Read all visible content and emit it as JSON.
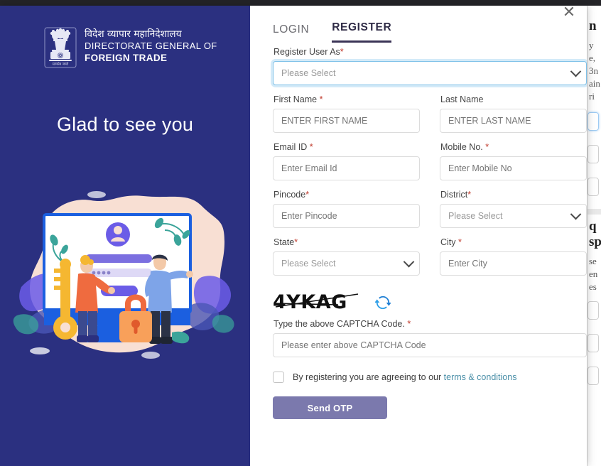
{
  "window": {
    "top_strip_color": "#242428"
  },
  "brand": {
    "hindi": "विदेश व्यापार महानिदेशालय",
    "line1": "DIRECTORATE GENERAL OF",
    "line2": "FOREIGN TRADE",
    "emblem_name": "india-national-emblem",
    "panel_color": "#2b3080"
  },
  "left": {
    "headline": "Glad to see you",
    "illustration_name": "login-security-illustration"
  },
  "modal": {
    "close_label": "✕"
  },
  "tabs": [
    {
      "label": "LOGIN",
      "active": false
    },
    {
      "label": "REGISTER",
      "active": true
    }
  ],
  "form": {
    "register_user_as": {
      "label": "Register User As",
      "required": true,
      "value": "Please Select",
      "focused": true
    },
    "first_name": {
      "label": "First Name",
      "required": true,
      "placeholder": "ENTER FIRST NAME",
      "value": ""
    },
    "last_name": {
      "label": "Last Name",
      "required": false,
      "placeholder": "ENTER LAST NAME",
      "value": ""
    },
    "email": {
      "label": "Email ID",
      "required": true,
      "placeholder": "Enter Email Id",
      "value": ""
    },
    "mobile": {
      "label": "Mobile No.",
      "required": true,
      "placeholder": "Enter Mobile No",
      "value": ""
    },
    "pincode": {
      "label": "Pincode",
      "required": true,
      "placeholder": "Enter Pincode",
      "value": ""
    },
    "district": {
      "label": "District",
      "required": true,
      "value": "Please Select"
    },
    "state": {
      "label": "State",
      "required": true,
      "value": "Please Select"
    },
    "city": {
      "label": "City",
      "required": true,
      "placeholder": "Enter City",
      "value": ""
    },
    "captcha": {
      "code": "4YKAG",
      "refresh_icon_name": "refresh-icon",
      "label": "Type the above CAPTCHA Code.",
      "required": true,
      "placeholder": "Please enter above CAPTCHA Code",
      "value": ""
    },
    "terms": {
      "checked": false,
      "text": "By registering you are agreeing to our",
      "link": "terms & conditions",
      "link_color": "#4a8fa8"
    },
    "submit": {
      "label": "Send OTP",
      "color": "#7b79ad"
    }
  },
  "background_page": {
    "fragments": [
      "n",
      "y",
      "e,",
      "3n",
      "ain",
      "ri",
      "q",
      "sp",
      "se",
      "en",
      "es"
    ]
  }
}
